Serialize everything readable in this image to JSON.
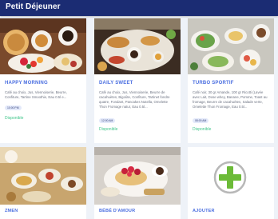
{
  "app": {
    "title": "Petit Déjeuner"
  },
  "colors": {
    "header_bg": "#1b2c73",
    "title_blue": "#4a6ee0",
    "status_green": "#3fc68a",
    "plus_green": "#6cbb38"
  },
  "menus": [
    {
      "title": "HAPPY MORNING",
      "description": "Café au choix, Jus, Viennoiserie, Beurre, Confiture, Tartine Smoothie, Eau 0.5l e...",
      "tag": "10:00 PM",
      "status": "Disponible",
      "image_icon": "pancake-breakfast-photo"
    },
    {
      "title": "DAILY SWEET",
      "description": "Café au choix, Jus, Viennoiserie, Beurre de cacahuètes, Bigoûte, Confiture, Tartinet fondre quatre, Fondant, Pancakes Nutella, Omelette Thon Fromage natur, Eau 0.5l...",
      "tag": "12:00 AM",
      "status": "Disponible",
      "image_icon": "croissant-tray-photo"
    },
    {
      "title": "TURBO SPORTIF",
      "description": "Café noir, 30 gr Amande, 100 gr Ricotti (Lavée avec Lait, Dose whey, Banane, Pomme, Toast au fromage, Beurre de cacahuètes, Salade verte, Omelette Thon Fromage, Eau 0.5l...",
      "tag": "08:00 AM",
      "status": "Disponible",
      "image_icon": "salad-table-photo"
    },
    {
      "title": "ZMEN",
      "image_icon": "tea-spread-photo"
    },
    {
      "title": "BÉBÉ D'AMOUR",
      "image_icon": "raspberry-pastry-photo"
    }
  ],
  "add_card": {
    "label": "AJOUTER",
    "icon": "plus-circle-icon"
  }
}
